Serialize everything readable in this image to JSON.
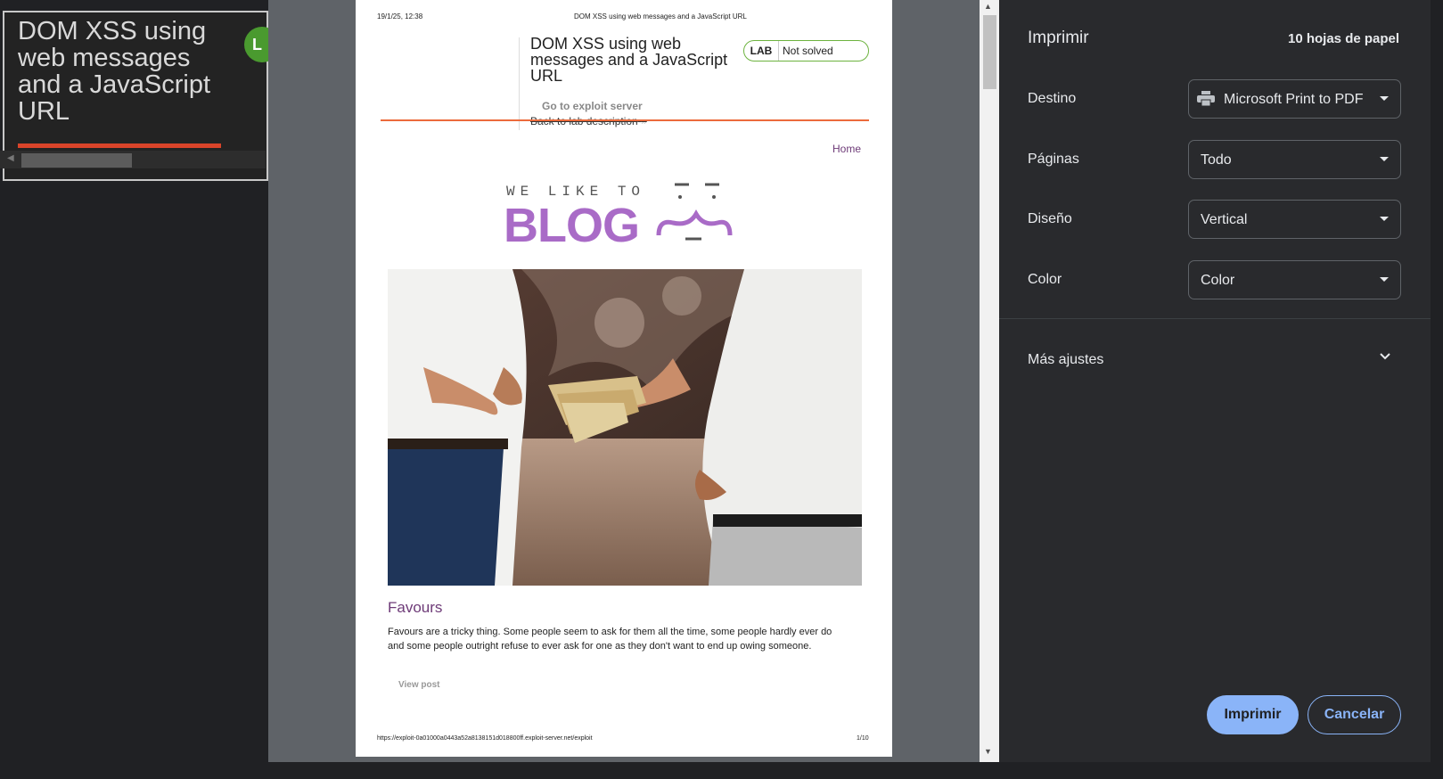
{
  "background_page": {
    "title": "DOM XSS using web messages and a JavaScript URL",
    "badge_letter": "L"
  },
  "preview": {
    "header_date": "19/1/25, 12:38",
    "header_title": "DOM XSS using web messages and a JavaScript URL",
    "lab_title": "DOM XSS using web messages and a JavaScript URL",
    "lab_badge": "LAB",
    "lab_status": "Not solved",
    "exploit_link": "Go to exploit server",
    "back_link": "Back to lab description",
    "back_link_suffix": "»",
    "home_link": "Home",
    "logo_top": "WE LIKE TO",
    "logo_main": "BLOG",
    "post_title": "Favours",
    "post_text": "Favours are a tricky thing. Some people seem to ask for them all the time, some people hardly ever do and some people outright refuse to ever ask for one as they don't want to end up owing someone.",
    "view_post": "View post",
    "footer_url": "https://exploit-0a01000a0443a52a8138151d018800ff.exploit-server.net/exploit",
    "footer_page": "1/10"
  },
  "settings": {
    "title": "Imprimir",
    "sheets": "10 hojas de papel",
    "destination": {
      "label": "Destino",
      "value": "Microsoft Print to PDF",
      "icon": "printer-icon"
    },
    "pages": {
      "label": "Páginas",
      "value": "Todo"
    },
    "layout": {
      "label": "Diseño",
      "value": "Vertical"
    },
    "color": {
      "label": "Color",
      "value": "Color"
    },
    "more_settings": "Más ajustes",
    "print_button": "Imprimir",
    "cancel_button": "Cancelar"
  },
  "colors": {
    "accent": "#8ab4f8",
    "panel_bg": "#292a2d",
    "lab_link_purple": "#6e3b78",
    "logo_purple": "#a96bc7",
    "orange_rule": "#ec6b3c"
  }
}
